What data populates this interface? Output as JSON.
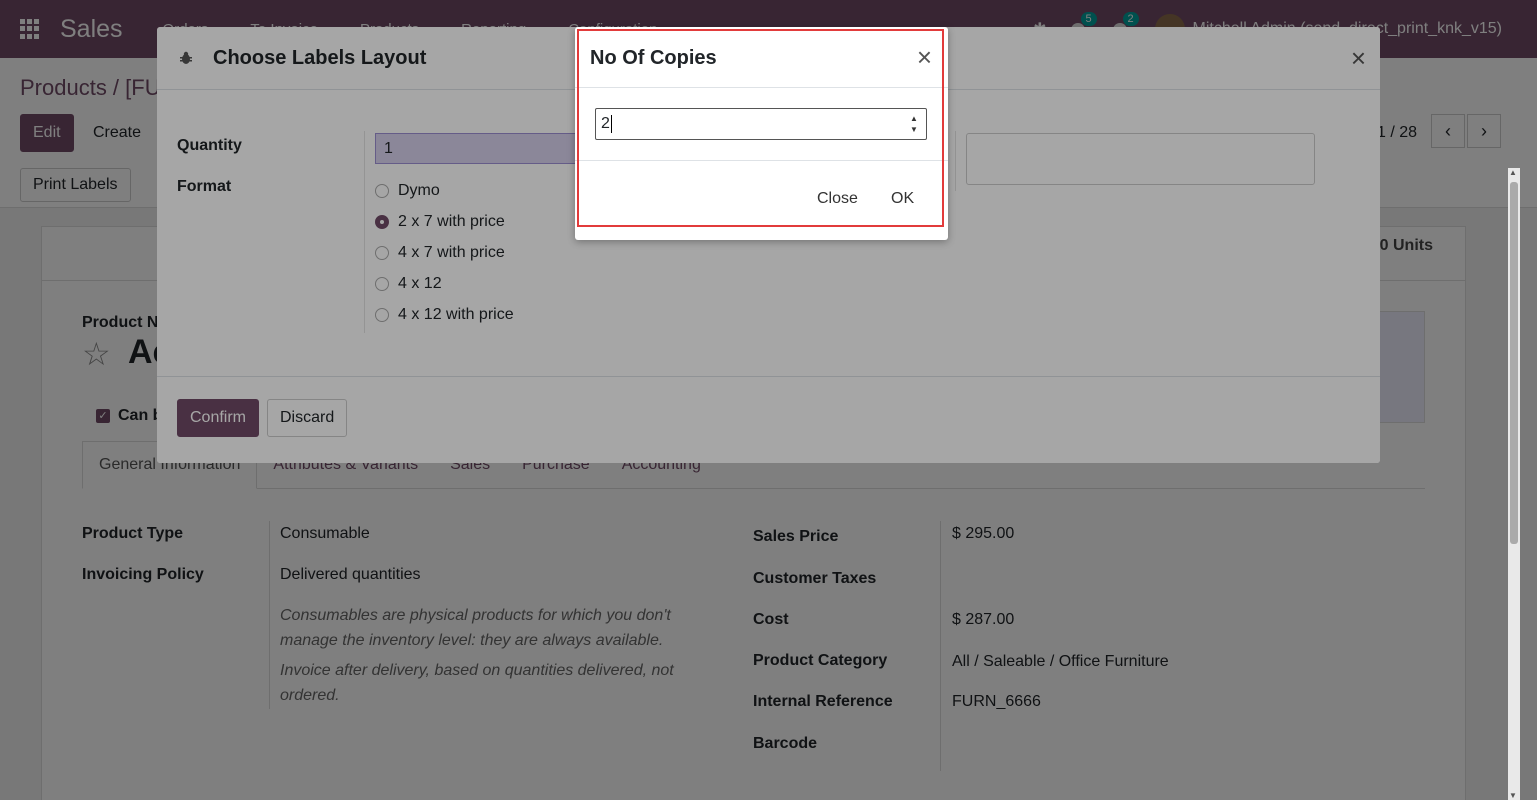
{
  "nav": {
    "brand": "Sales",
    "menu": [
      "Orders",
      "To Invoice",
      "Products",
      "Reporting",
      "Configuration"
    ],
    "activity_count": "5",
    "message_count": "2",
    "user": "Mitchell Admin (send_direct_print_knk_v15)"
  },
  "control_panel": {
    "breadcrumb": "Products / [FU",
    "edit_label": "Edit",
    "create_label": "Create",
    "print_labels_label": "Print Labels",
    "pager": "1 / 28"
  },
  "form": {
    "units_stat": "0 Units",
    "product_name_label": "Product N",
    "title_partial": "Ac",
    "can_be_label": "Can b",
    "tabs": [
      "General Information",
      "Attributes & Variants",
      "Sales",
      "Purchase",
      "Accounting"
    ],
    "left_fields": [
      {
        "label": "Product Type",
        "value": "Consumable"
      },
      {
        "label": "Invoicing Policy",
        "value": "Delivered quantities"
      }
    ],
    "help_1": "Consumables are physical products for which you don't manage the inventory level: they are always available.",
    "help_2": "Invoice after delivery, based on quantities delivered, not ordered.",
    "right_fields": [
      {
        "label": "Sales Price",
        "value": "$ 295.00"
      },
      {
        "label": "Customer Taxes",
        "value": ""
      },
      {
        "label": "Cost",
        "value": "$ 287.00"
      },
      {
        "label": "Product Category",
        "value": "All / Saleable / Office Furniture"
      },
      {
        "label": "Internal Reference",
        "value": "FURN_6666"
      },
      {
        "label": "Barcode",
        "value": ""
      }
    ]
  },
  "labels_dialog": {
    "title": "Choose Labels Layout",
    "quantity_label": "Quantity",
    "quantity_value": "1",
    "format_label": "Format",
    "formats": [
      "Dymo",
      "2 x 7 with price",
      "4 x 7 with price",
      "4 x 12",
      "4 x 12 with price"
    ],
    "selected_format": "2 x 7 with price",
    "confirm_label": "Confirm",
    "discard_label": "Discard"
  },
  "copies_dialog": {
    "title": "No Of Copies",
    "value": "2",
    "close_label": "Close",
    "ok_label": "OK"
  },
  "colors": {
    "brand": "#714b67",
    "highlight": "#e23b3b"
  }
}
